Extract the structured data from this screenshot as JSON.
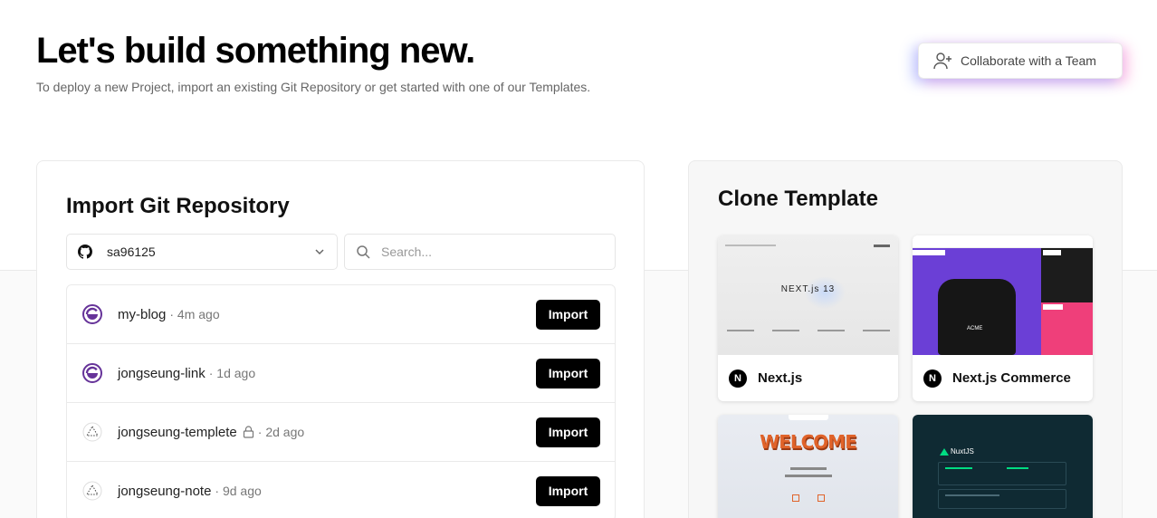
{
  "header": {
    "title": "Let's build something new.",
    "subtitle": "To deploy a new Project, import an existing Git Repository or get started with one of our Templates.",
    "collaborate_label": "Collaborate with a Team"
  },
  "import": {
    "title": "Import Git Repository",
    "account": "sa96125",
    "search_placeholder": "Search...",
    "repos": [
      {
        "name": "my-blog",
        "meta": "· 4m ago",
        "icon": "gatsby-icon",
        "private": false,
        "button": "Import"
      },
      {
        "name": "jongseung-link",
        "meta": "· 1d ago",
        "icon": "gatsby-icon",
        "private": false,
        "button": "Import"
      },
      {
        "name": "jongseung-templete",
        "meta": "· 2d ago",
        "icon": "vercel-triangle-icon",
        "private": true,
        "button": "Import"
      },
      {
        "name": "jongseung-note",
        "meta": "· 9d ago",
        "icon": "vercel-triangle-icon",
        "private": false,
        "button": "Import"
      }
    ]
  },
  "clone": {
    "title": "Clone Template",
    "templates": [
      {
        "name": "Next.js",
        "logo": "N",
        "thumb_text": "NEXT.js 13"
      },
      {
        "name": "Next.js Commerce",
        "logo": "N",
        "thumb_text": "ACME"
      },
      {
        "name": "",
        "thumb_text": "WELCOME"
      },
      {
        "name": "",
        "thumb_text": "NuxtJS"
      }
    ]
  },
  "colors": {
    "gatsby": "#663399",
    "button_bg": "#000000",
    "commerce_purple": "#6b3fd6",
    "commerce_pink": "#ef3f7a",
    "nuxt_bg": "#0f2a33",
    "nuxt_green": "#00dc82"
  }
}
